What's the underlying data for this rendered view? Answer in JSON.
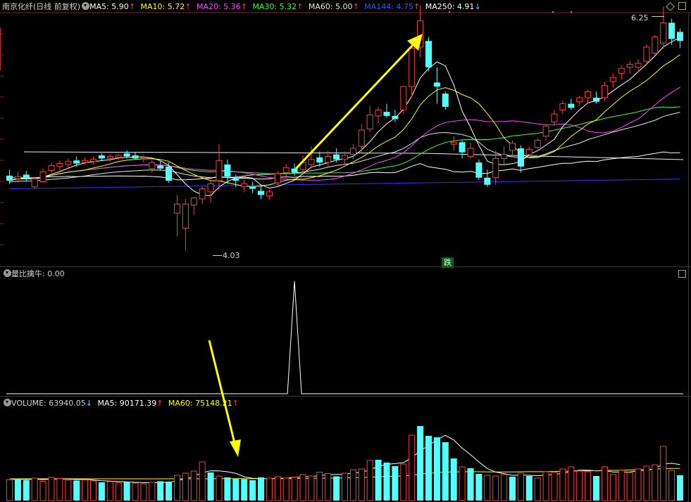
{
  "stock": {
    "name": "南京化纤",
    "period_label": "(日线 前复权)"
  },
  "main_header": {
    "ma5_label": "MA5: 5.90",
    "ma10_label": "MA10: 5.72",
    "ma20_label": "MA20: 5.36",
    "ma30_label": "MA30: 5.32",
    "ma60_label": "MA60: 5.00",
    "ma144_label": "MA144: 4.75",
    "ma250_label": "MA250: 4.91",
    "up_arrow": "↑",
    "down_arrow": "↓"
  },
  "main_chart": {
    "high_label": "6.25",
    "low_label": "4.03",
    "fall_badge": "跌"
  },
  "indicator_header": {
    "name": "量比擒牛",
    "value": ": 0.00"
  },
  "volume_header": {
    "volume_label": "VOLUME: 63940.05",
    "ma5_label": "MA5: 90171.39",
    "ma60_label": "MA60: 75148.21",
    "up_arrow": "↑",
    "down_arrow": "↓"
  },
  "colors": {
    "ma5": "#ffffff",
    "ma10": "#ffff00",
    "ma20": "#ff44ff",
    "ma30": "#33ff33",
    "ma60": "#e6e6e6",
    "ma144": "#3333ff",
    "ma250": "#ffffff",
    "up_candle": "#ff3b3b",
    "down_candle": "#54ffff",
    "annotation_arrow": "#ffff00"
  },
  "chart_data": [
    {
      "type": "candlestick",
      "title": "南京化纤(日线 前复权)",
      "price_range": [
        3.9,
        6.4
      ],
      "annotations": [
        {
          "text": "6.25"
        },
        {
          "text": "4.03"
        },
        {
          "text": "跌"
        }
      ],
      "candles": [
        {
          "o": 4.79,
          "h": 4.85,
          "l": 4.71,
          "c": 4.74
        },
        {
          "o": 4.76,
          "h": 4.83,
          "l": 4.72,
          "c": 4.78
        },
        {
          "o": 4.8,
          "h": 4.84,
          "l": 4.73,
          "c": 4.76
        },
        {
          "o": 4.68,
          "h": 4.78,
          "l": 4.66,
          "c": 4.76
        },
        {
          "o": 4.73,
          "h": 4.86,
          "l": 4.72,
          "c": 4.83
        },
        {
          "o": 4.84,
          "h": 4.92,
          "l": 4.82,
          "c": 4.89
        },
        {
          "o": 4.88,
          "h": 4.94,
          "l": 4.84,
          "c": 4.91
        },
        {
          "o": 4.9,
          "h": 4.96,
          "l": 4.87,
          "c": 4.93
        },
        {
          "o": 4.94,
          "h": 4.98,
          "l": 4.88,
          "c": 4.91
        },
        {
          "o": 4.92,
          "h": 4.97,
          "l": 4.9,
          "c": 4.94
        },
        {
          "o": 4.93,
          "h": 4.98,
          "l": 4.9,
          "c": 4.95
        },
        {
          "o": 4.99,
          "h": 5.01,
          "l": 4.94,
          "c": 4.96
        },
        {
          "o": 4.96,
          "h": 5.0,
          "l": 4.93,
          "c": 4.98
        },
        {
          "o": 4.97,
          "h": 5.0,
          "l": 4.95,
          "c": 4.99
        },
        {
          "o": 5.01,
          "h": 5.04,
          "l": 4.96,
          "c": 4.98
        },
        {
          "o": 4.99,
          "h": 5.02,
          "l": 4.95,
          "c": 4.96
        },
        {
          "o": 4.96,
          "h": 4.99,
          "l": 4.92,
          "c": 4.97
        },
        {
          "o": 4.86,
          "h": 4.94,
          "l": 4.82,
          "c": 4.92
        },
        {
          "o": 4.89,
          "h": 4.94,
          "l": 4.84,
          "c": 4.86
        },
        {
          "o": 4.88,
          "h": 4.92,
          "l": 4.72,
          "c": 4.74
        },
        {
          "o": 4.42,
          "h": 4.6,
          "l": 4.19,
          "c": 4.51
        },
        {
          "o": 4.27,
          "h": 4.56,
          "l": 4.05,
          "c": 4.51
        },
        {
          "o": 4.5,
          "h": 4.58,
          "l": 4.4,
          "c": 4.57
        },
        {
          "o": 4.56,
          "h": 4.68,
          "l": 4.51,
          "c": 4.66
        },
        {
          "o": 4.63,
          "h": 4.78,
          "l": 4.52,
          "c": 4.71
        },
        {
          "o": 4.74,
          "h": 5.1,
          "l": 4.64,
          "c": 4.94
        },
        {
          "o": 4.9,
          "h": 4.95,
          "l": 4.71,
          "c": 4.78
        },
        {
          "o": 4.76,
          "h": 4.8,
          "l": 4.68,
          "c": 4.74
        },
        {
          "o": 4.68,
          "h": 4.75,
          "l": 4.63,
          "c": 4.71
        },
        {
          "o": 4.68,
          "h": 4.73,
          "l": 4.62,
          "c": 4.66
        },
        {
          "o": 4.64,
          "h": 4.7,
          "l": 4.56,
          "c": 4.6
        },
        {
          "o": 4.59,
          "h": 4.65,
          "l": 4.55,
          "c": 4.63
        },
        {
          "o": 4.72,
          "h": 4.83,
          "l": 4.68,
          "c": 4.81
        },
        {
          "o": 4.82,
          "h": 4.9,
          "l": 4.78,
          "c": 4.87
        },
        {
          "o": 4.86,
          "h": 4.91,
          "l": 4.79,
          "c": 4.82
        },
        {
          "o": 4.85,
          "h": 4.99,
          "l": 4.8,
          "c": 4.92
        },
        {
          "o": 4.9,
          "h": 5.08,
          "l": 4.86,
          "c": 4.95
        },
        {
          "o": 4.97,
          "h": 5.03,
          "l": 4.88,
          "c": 4.92
        },
        {
          "o": 4.92,
          "h": 5.04,
          "l": 4.88,
          "c": 4.98
        },
        {
          "o": 5.0,
          "h": 5.06,
          "l": 4.92,
          "c": 4.95
        },
        {
          "o": 4.95,
          "h": 5.03,
          "l": 4.9,
          "c": 4.99
        },
        {
          "o": 5.0,
          "h": 5.1,
          "l": 4.95,
          "c": 5.06
        },
        {
          "o": 5.08,
          "h": 5.3,
          "l": 5.02,
          "c": 5.24
        },
        {
          "o": 5.25,
          "h": 5.48,
          "l": 5.22,
          "c": 5.39
        },
        {
          "o": 5.38,
          "h": 5.47,
          "l": 5.31,
          "c": 5.44
        },
        {
          "o": 5.42,
          "h": 5.5,
          "l": 5.36,
          "c": 5.38
        },
        {
          "o": 5.38,
          "h": 5.44,
          "l": 5.32,
          "c": 5.35
        },
        {
          "o": 5.44,
          "h": 5.68,
          "l": 5.4,
          "c": 5.67
        },
        {
          "o": 5.67,
          "h": 6.09,
          "l": 5.57,
          "c": 6.05
        },
        {
          "o": 6.06,
          "h": 6.47,
          "l": 5.96,
          "c": 6.32
        },
        {
          "o": 6.12,
          "h": 6.16,
          "l": 5.82,
          "c": 5.86
        },
        {
          "o": 5.71,
          "h": 5.86,
          "l": 5.5,
          "c": 5.67
        },
        {
          "o": 5.6,
          "h": 5.62,
          "l": 5.44,
          "c": 5.47
        },
        {
          "o": 5.1,
          "h": 5.18,
          "l": 5.04,
          "c": 5.12
        },
        {
          "o": 5.12,
          "h": 5.14,
          "l": 4.96,
          "c": 5.02
        },
        {
          "o": 4.98,
          "h": 5.12,
          "l": 4.96,
          "c": 5.06
        },
        {
          "o": 4.92,
          "h": 4.95,
          "l": 4.75,
          "c": 4.77
        },
        {
          "o": 4.77,
          "h": 4.85,
          "l": 4.68,
          "c": 4.7
        },
        {
          "o": 4.77,
          "h": 5.04,
          "l": 4.7,
          "c": 4.96
        },
        {
          "o": 4.96,
          "h": 5.08,
          "l": 4.9,
          "c": 5.0
        },
        {
          "o": 5.04,
          "h": 5.14,
          "l": 4.98,
          "c": 5.11
        },
        {
          "o": 5.06,
          "h": 5.09,
          "l": 4.82,
          "c": 4.88
        },
        {
          "o": 5.0,
          "h": 5.08,
          "l": 4.96,
          "c": 5.05
        },
        {
          "o": 5.07,
          "h": 5.16,
          "l": 5.05,
          "c": 5.14
        },
        {
          "o": 5.18,
          "h": 5.3,
          "l": 5.14,
          "c": 5.28
        },
        {
          "o": 5.32,
          "h": 5.44,
          "l": 5.28,
          "c": 5.4
        },
        {
          "o": 5.44,
          "h": 5.53,
          "l": 5.4,
          "c": 5.5
        },
        {
          "o": 5.5,
          "h": 5.55,
          "l": 5.44,
          "c": 5.46
        },
        {
          "o": 5.52,
          "h": 5.58,
          "l": 5.48,
          "c": 5.56
        },
        {
          "o": 5.56,
          "h": 5.64,
          "l": 5.51,
          "c": 5.62
        },
        {
          "o": 5.56,
          "h": 5.62,
          "l": 5.5,
          "c": 5.52
        },
        {
          "o": 5.56,
          "h": 5.72,
          "l": 5.53,
          "c": 5.68
        },
        {
          "o": 5.72,
          "h": 5.8,
          "l": 5.66,
          "c": 5.76
        },
        {
          "o": 5.8,
          "h": 5.88,
          "l": 5.74,
          "c": 5.85
        },
        {
          "o": 5.86,
          "h": 5.92,
          "l": 5.8,
          "c": 5.89
        },
        {
          "o": 5.86,
          "h": 5.94,
          "l": 5.81,
          "c": 5.9
        },
        {
          "o": 5.92,
          "h": 6.09,
          "l": 5.88,
          "c": 6.06
        },
        {
          "o": 6.0,
          "h": 6.18,
          "l": 5.98,
          "c": 6.16
        },
        {
          "o": 6.1,
          "h": 6.46,
          "l": 6.04,
          "c": 6.3
        },
        {
          "o": 6.3,
          "h": 6.34,
          "l": 6.08,
          "c": 6.14
        },
        {
          "o": 6.21,
          "h": 6.24,
          "l": 6.05,
          "c": 6.12
        }
      ]
    },
    {
      "type": "line",
      "title": "量比擒牛",
      "series": [
        {
          "name": "量比擒牛",
          "values": [
            0,
            0,
            0,
            0,
            0,
            0,
            0,
            0,
            0,
            0,
            0,
            0,
            0,
            0,
            0,
            0,
            0,
            0,
            0,
            0,
            0,
            0,
            0,
            0,
            0,
            0,
            0,
            0,
            0,
            0,
            0,
            0,
            0,
            0,
            1,
            0,
            0,
            0,
            0,
            0,
            0,
            0,
            0,
            0,
            0,
            0,
            0,
            0,
            0,
            0,
            0,
            0,
            0,
            0,
            0,
            0,
            0,
            0,
            0,
            0,
            0,
            0,
            0,
            0,
            0,
            0,
            0,
            0,
            0,
            0,
            0,
            0,
            0,
            0,
            0,
            0,
            0,
            0,
            0,
            0,
            0
          ]
        }
      ]
    },
    {
      "type": "bar",
      "title": "VOLUME",
      "values": [
        60,
        62,
        58,
        64,
        55,
        66,
        63,
        58,
        57,
        59,
        56,
        52,
        54,
        51,
        53,
        50,
        48,
        52,
        55,
        54,
        72,
        78,
        84,
        110,
        80,
        70,
        66,
        62,
        61,
        58,
        66,
        64,
        68,
        64,
        67,
        74,
        70,
        81,
        77,
        69,
        78,
        88,
        90,
        114,
        116,
        108,
        98,
        104,
        186,
        212,
        184,
        180,
        166,
        120,
        96,
        92,
        76,
        72,
        70,
        74,
        68,
        78,
        70,
        64,
        82,
        80,
        90,
        96,
        84,
        82,
        70,
        96,
        74,
        86,
        80,
        90,
        98,
        102,
        154,
        86,
        72
      ],
      "down_days": [
        1,
        2,
        8,
        11,
        14,
        18,
        19,
        24,
        26,
        27,
        28,
        29,
        30,
        39,
        44,
        45,
        46,
        49,
        50,
        51,
        52,
        53,
        55,
        56,
        60,
        62,
        70,
        80
      ]
    }
  ]
}
